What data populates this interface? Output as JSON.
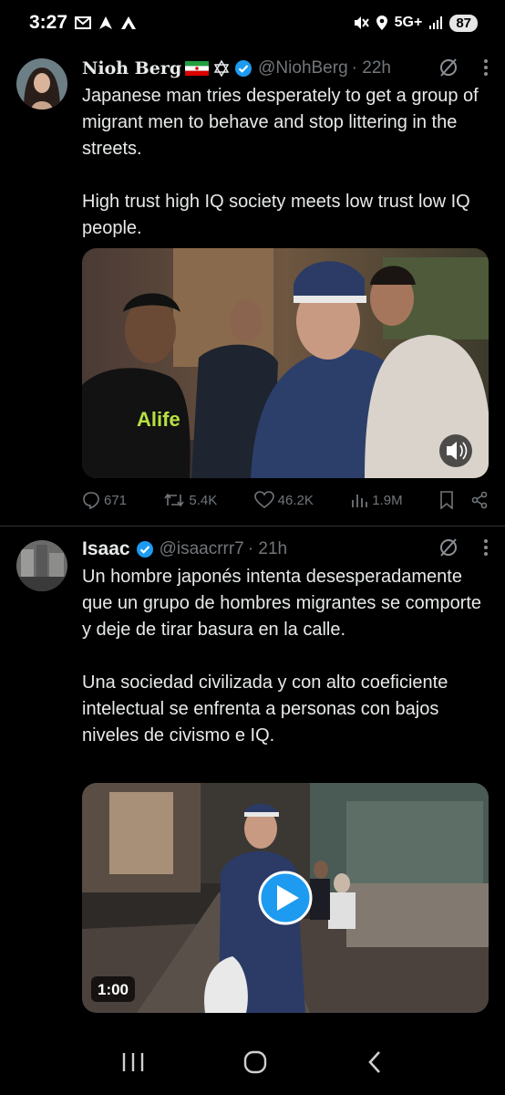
{
  "status": {
    "time": "3:27",
    "network": "5G+",
    "battery": "87",
    "left_icons": [
      "gmail-icon",
      "nav-arrow-icon",
      "app-a-icon"
    ],
    "right_icons": [
      "mute-icon",
      "location-icon",
      "signal-icon"
    ]
  },
  "tweets": [
    {
      "name": "Nioh Berg",
      "flags": [
        "iran-flag-icon",
        "star-of-david-icon"
      ],
      "verified": true,
      "handle": "@NiohBerg",
      "time": "· 22h",
      "paragraphs": [
        "Japanese man tries desperately to get a group of migrant men to behave and stop littering in the streets.",
        "High trust high IQ society meets low trust low IQ people."
      ],
      "media": {
        "type": "video",
        "shirt_text": "Alife",
        "audio_icon": "volume-icon"
      },
      "stats": {
        "replies": "671",
        "retweets": "5.4K",
        "likes": "46.2K",
        "views": "1.9M"
      }
    },
    {
      "name": "Isaac",
      "verified": true,
      "handle": "@isaacrrr7",
      "time": "· 21h",
      "paragraphs": [
        "Un hombre japonés intenta desesperadamente que un grupo de hombres migrantes se comporte y deje de tirar basura en la calle.",
        "Una sociedad civilizada y con alto coeficiente intelectual se enfrenta a personas con bajos niveles de civismo e IQ."
      ],
      "media": {
        "type": "video",
        "duration": "1:00",
        "play_icon": "play-icon"
      }
    }
  ],
  "colors": {
    "background": "#000000",
    "text": "#e7e9ea",
    "muted": "#71767b",
    "verified": "#1d9bf0",
    "divider": "#2f3336"
  },
  "nav": [
    "recent-apps-icon",
    "home-icon",
    "back-icon"
  ]
}
